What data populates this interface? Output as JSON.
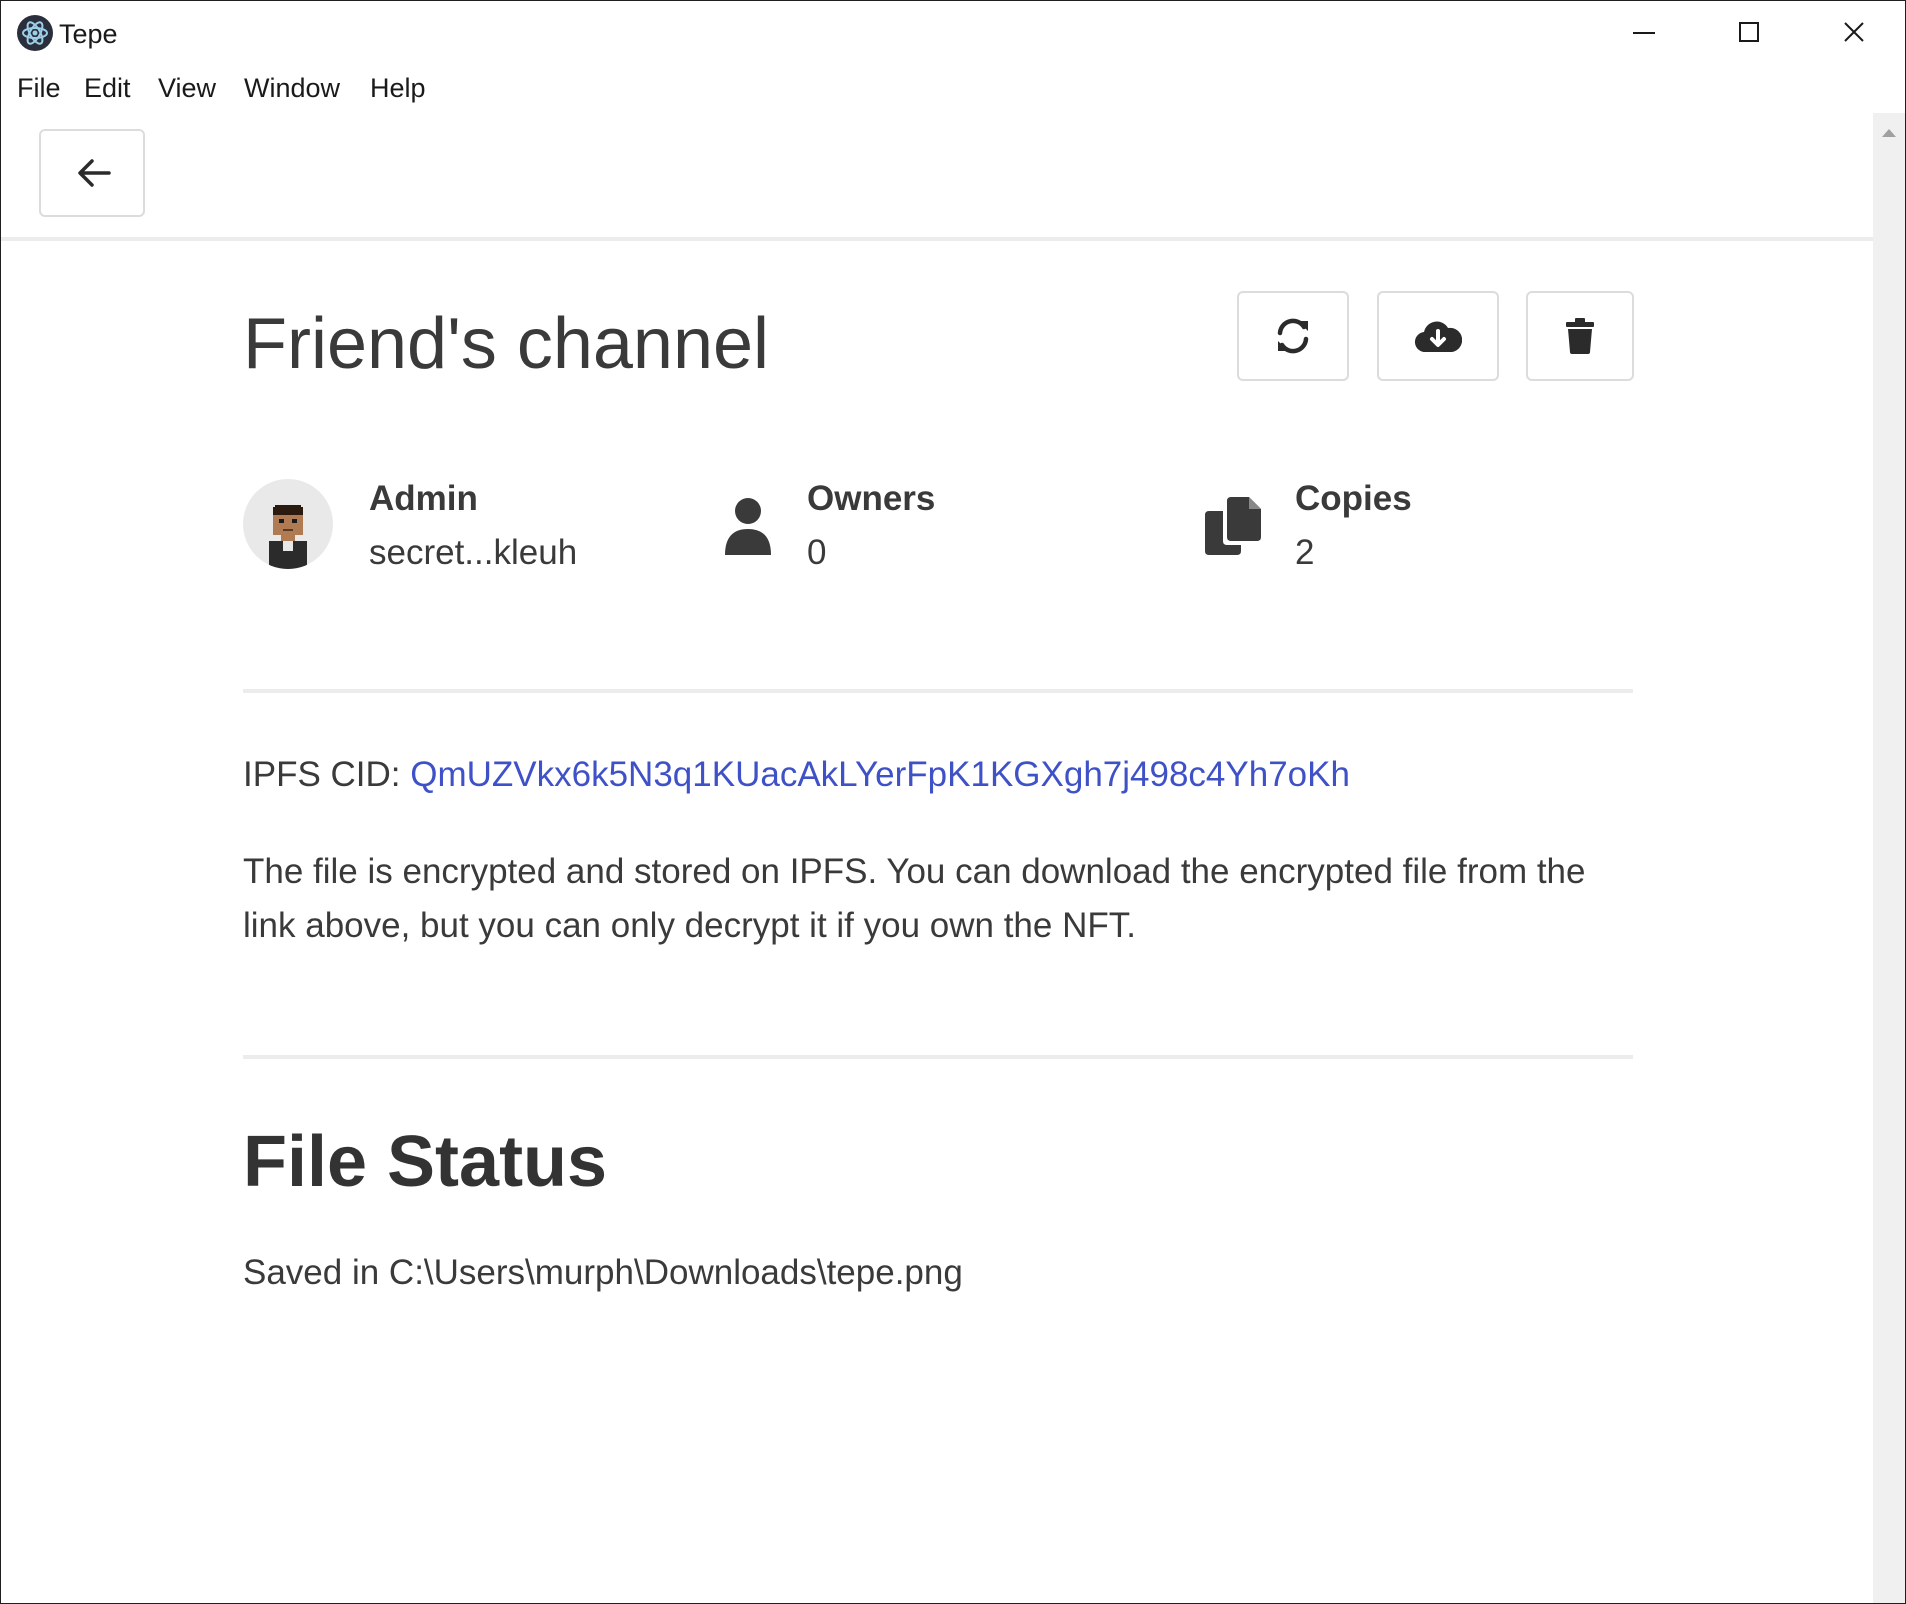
{
  "window": {
    "title": "Tepe"
  },
  "menu": [
    "File",
    "Edit",
    "View",
    "Window",
    "Help"
  ],
  "page": {
    "title": "Friend's channel",
    "stats": {
      "admin": {
        "label": "Admin",
        "value": "secret...kleuh"
      },
      "owners": {
        "label": "Owners",
        "value": "0"
      },
      "copies": {
        "label": "Copies",
        "value": "2"
      }
    },
    "ipfs": {
      "label": "IPFS CID: ",
      "cid": "QmUZVkx6k5N3q1KUacAkLYerFpK1KGXgh7j498c4Yh7oKh"
    },
    "description": "The file is encrypted and stored on IPFS. You can download the encrypted file from the link above, but you can only decrypt it if you own the NFT.",
    "file_status": {
      "title": "File Status",
      "text": "Saved in C:\\Users\\murph\\Downloads\\tepe.png"
    }
  },
  "icons": {
    "back": "arrow-left-icon",
    "refresh": "refresh-icon",
    "download": "cloud-download-icon",
    "delete": "trash-icon",
    "owners": "user-icon",
    "copies": "copy-icon"
  },
  "colors": {
    "link": "#3f51c7",
    "text": "#3a3a3a",
    "divider": "#ececec"
  }
}
